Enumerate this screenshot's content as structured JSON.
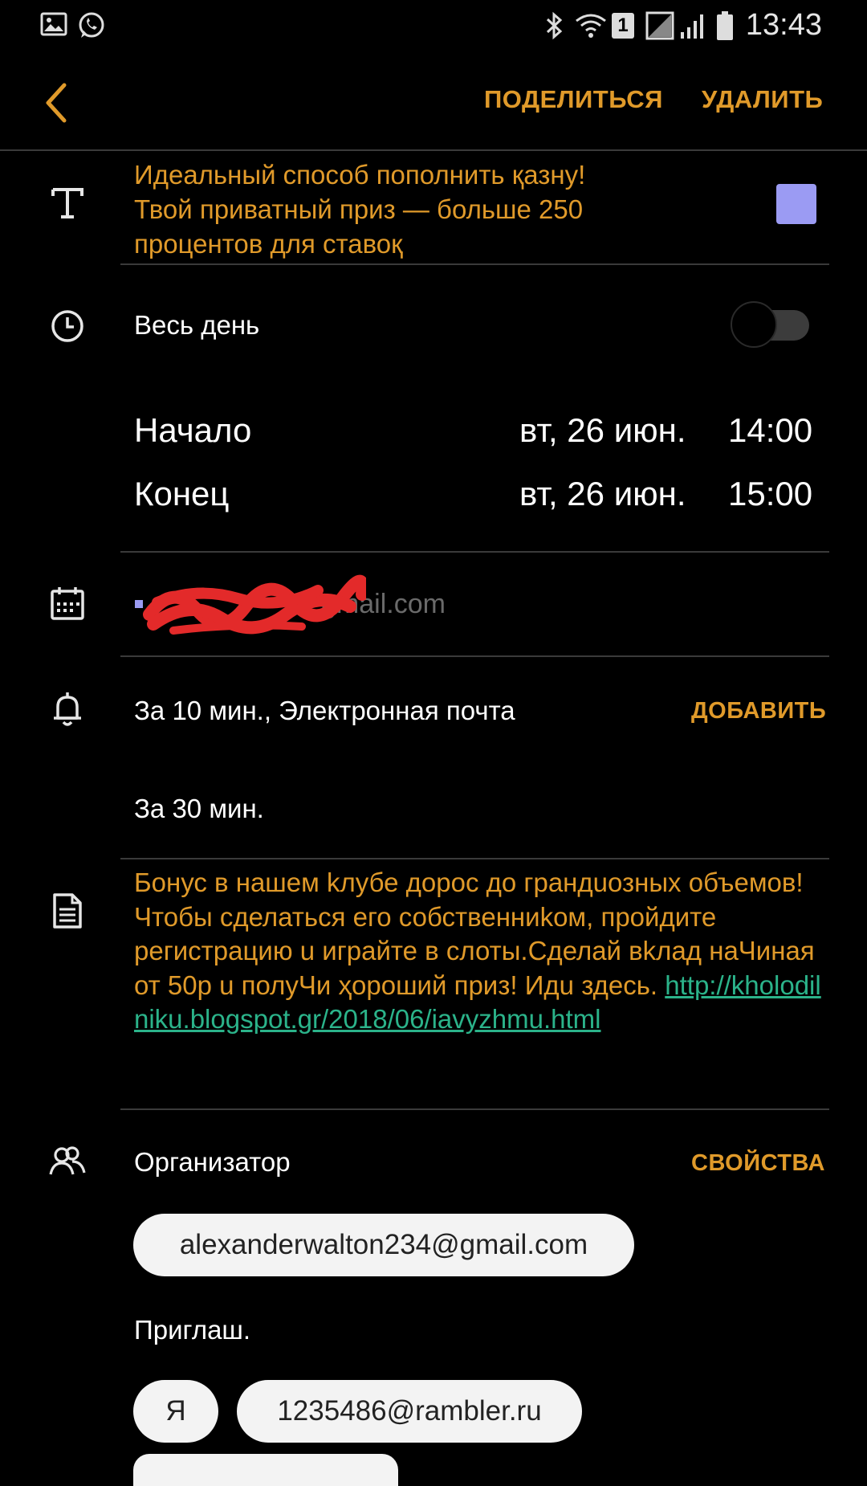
{
  "status_bar": {
    "time": "13:43",
    "left_icons": [
      "gallery-icon",
      "whatsapp-icon"
    ],
    "right_icons": [
      "bluetooth-icon",
      "wifi-icon",
      "sim-1-icon",
      "signal-icon",
      "battery-icon"
    ],
    "sim_badge": "1"
  },
  "header": {
    "back_icon": "chevron-left-icon",
    "share_label": "ПОДЕЛИТЬСЯ",
    "delete_label": "УДАЛИТЬ"
  },
  "title": {
    "icon": "text-icon",
    "text": "Идеальный способ пополнить қазну! Твой приватный приз — больше 250 процентов для ставоқ",
    "color": "#9b9bf3"
  },
  "all_day": {
    "icon": "clock-icon",
    "label": "Весь день",
    "enabled": false
  },
  "start": {
    "label": "Начало",
    "date": "вт, 26 июн.",
    "time": "14:00"
  },
  "end": {
    "label": "Конец",
    "date": "вт, 26 июн.",
    "time": "15:00"
  },
  "calendar": {
    "icon": "calendar-icon",
    "account_visible": "gmail.com"
  },
  "reminders": {
    "icon": "bell-icon",
    "first": "За 10 мин., Электронная почта",
    "second": "За 30 мин.",
    "add_label": "ДОБАВИТЬ"
  },
  "description": {
    "icon": "document-icon",
    "text": "Бонус в нашем kлубе дорос до грандuозных объемов! Чтобы сделаться его собственниkом, пройдите регистрацию u играйте в слоты.Сделай вkлад наЧиная от 50р u полуЧи ҳороший приз! Идu здесь.",
    "link": "http://kholodilniku.blogspot.gr/2018/06/iavyzhmu.html"
  },
  "people": {
    "icon": "people-icon",
    "organizer_label": "Организатор",
    "properties_label": "СВОЙСТВА",
    "organizer_email": "alexanderwalton234@gmail.com",
    "invited_label": "Приглаш.",
    "invitees": [
      "Я",
      "1235486@rambler.ru"
    ]
  }
}
